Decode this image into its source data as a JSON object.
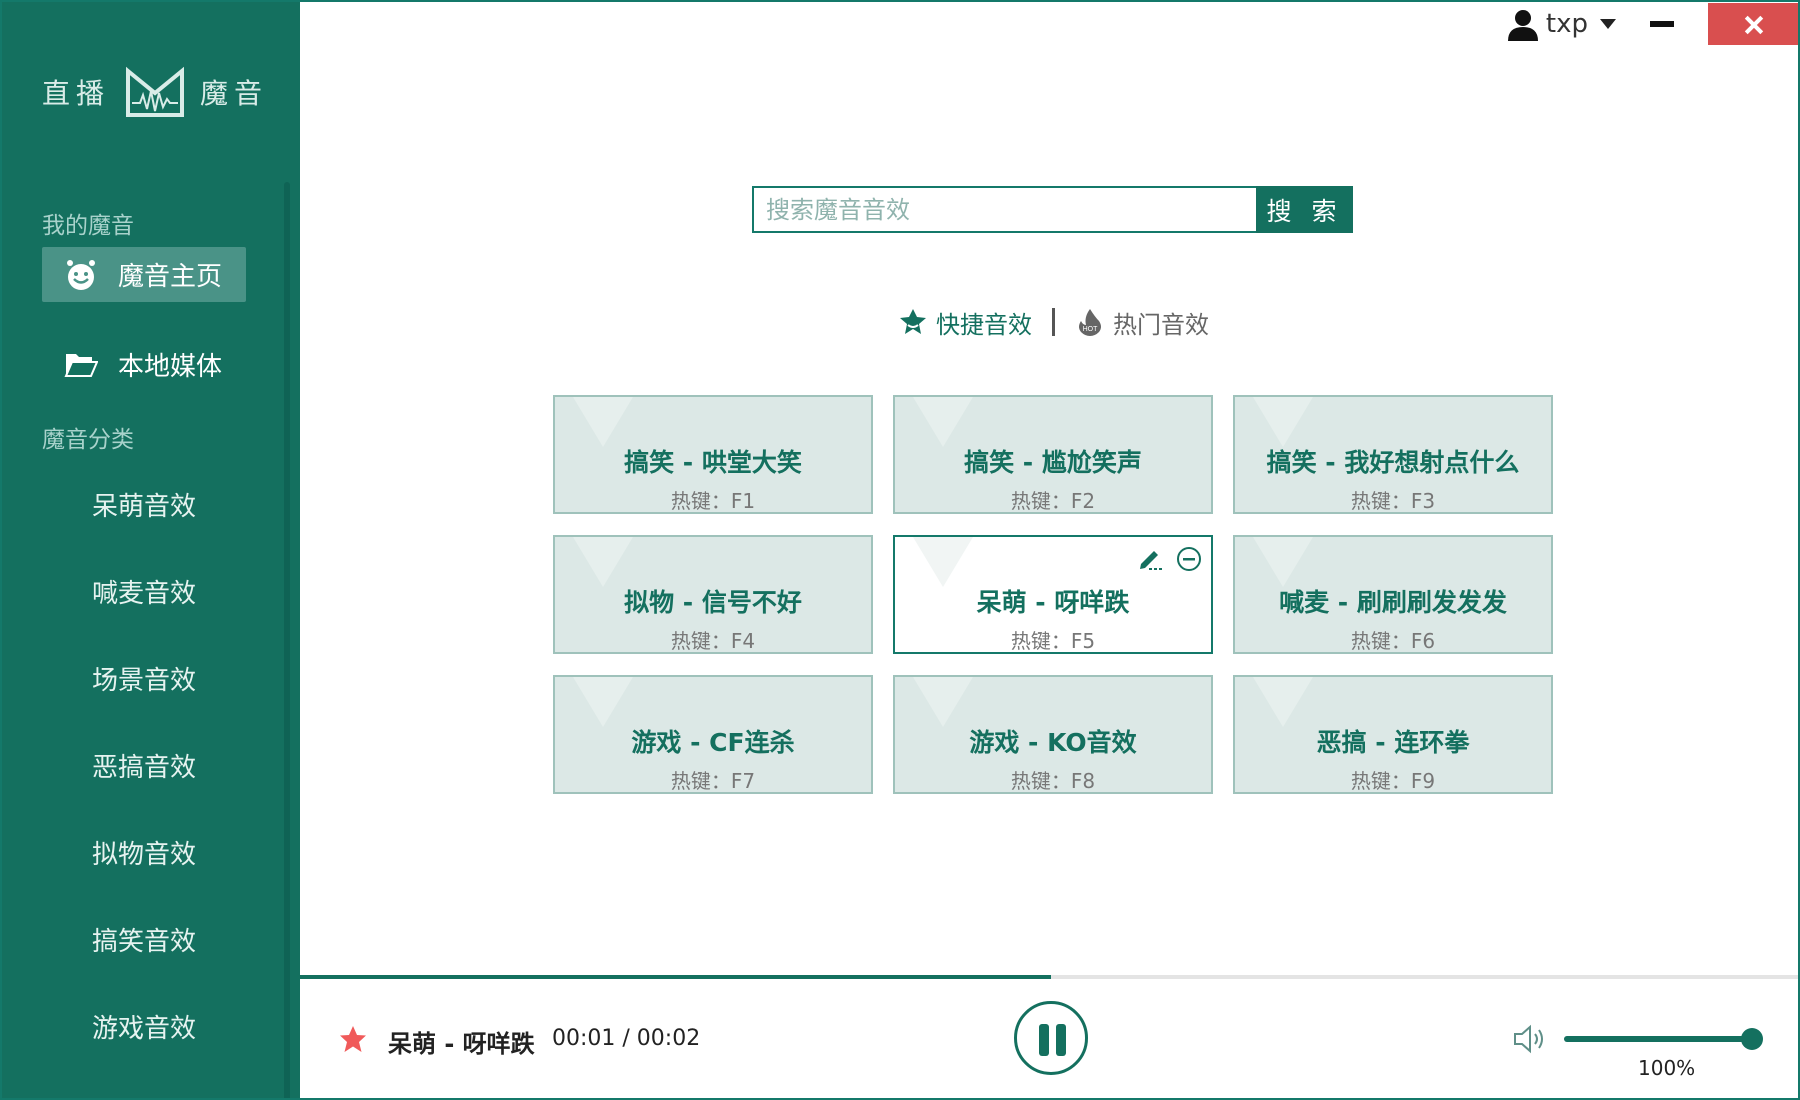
{
  "app": {
    "logo_left": "直播",
    "logo_right": "魔音",
    "logo_icon": "m-wave-logo"
  },
  "sidebar": {
    "section_my": "我的魔音",
    "home_label": "魔音主页",
    "home_icon": "smiley-face-icon",
    "local_label": "本地媒体",
    "local_icon": "folder-open-icon",
    "section_category": "魔音分类",
    "categories": [
      "呆萌音效",
      "喊麦音效",
      "场景音效",
      "恶搞音效",
      "拟物音效",
      "搞笑音效",
      "游戏音效"
    ]
  },
  "topbar": {
    "username": "txp",
    "user_icon": "user-icon"
  },
  "search": {
    "placeholder": "搜索魔音音效",
    "button": "搜 索"
  },
  "tabs": {
    "quick": "快捷音效",
    "hot": "热门音效"
  },
  "cards": [
    {
      "title": "搞笑 - 哄堂大笑",
      "hotkey": "热键：F1"
    },
    {
      "title": "搞笑 - 尴尬笑声",
      "hotkey": "热键：F2"
    },
    {
      "title": "搞笑 - 我好想射点什么",
      "hotkey": "热键：F3"
    },
    {
      "title": "拟物 - 信号不好",
      "hotkey": "热键：F4"
    },
    {
      "title": "呆萌 - 呀咩跌",
      "hotkey": "热键：F5"
    },
    {
      "title": "喊麦 - 刷刷刷发发发",
      "hotkey": "热键：F6"
    },
    {
      "title": "游戏 - CF连杀",
      "hotkey": "热键：F7"
    },
    {
      "title": "游戏 - KO音效",
      "hotkey": "热键：F8"
    },
    {
      "title": "恶搞 - 连环拳",
      "hotkey": "热键：F9"
    }
  ],
  "player": {
    "title": "呆萌 - 呀咩跌",
    "time": "00:01 / 00:02",
    "progress": 0.5,
    "volume": 1.0,
    "volume_label": "100%"
  },
  "colors": {
    "primary": "#14705f",
    "sidebar_active": "#4a9387",
    "close_red": "#d94f4f",
    "card_bg": "#dce8e6"
  }
}
